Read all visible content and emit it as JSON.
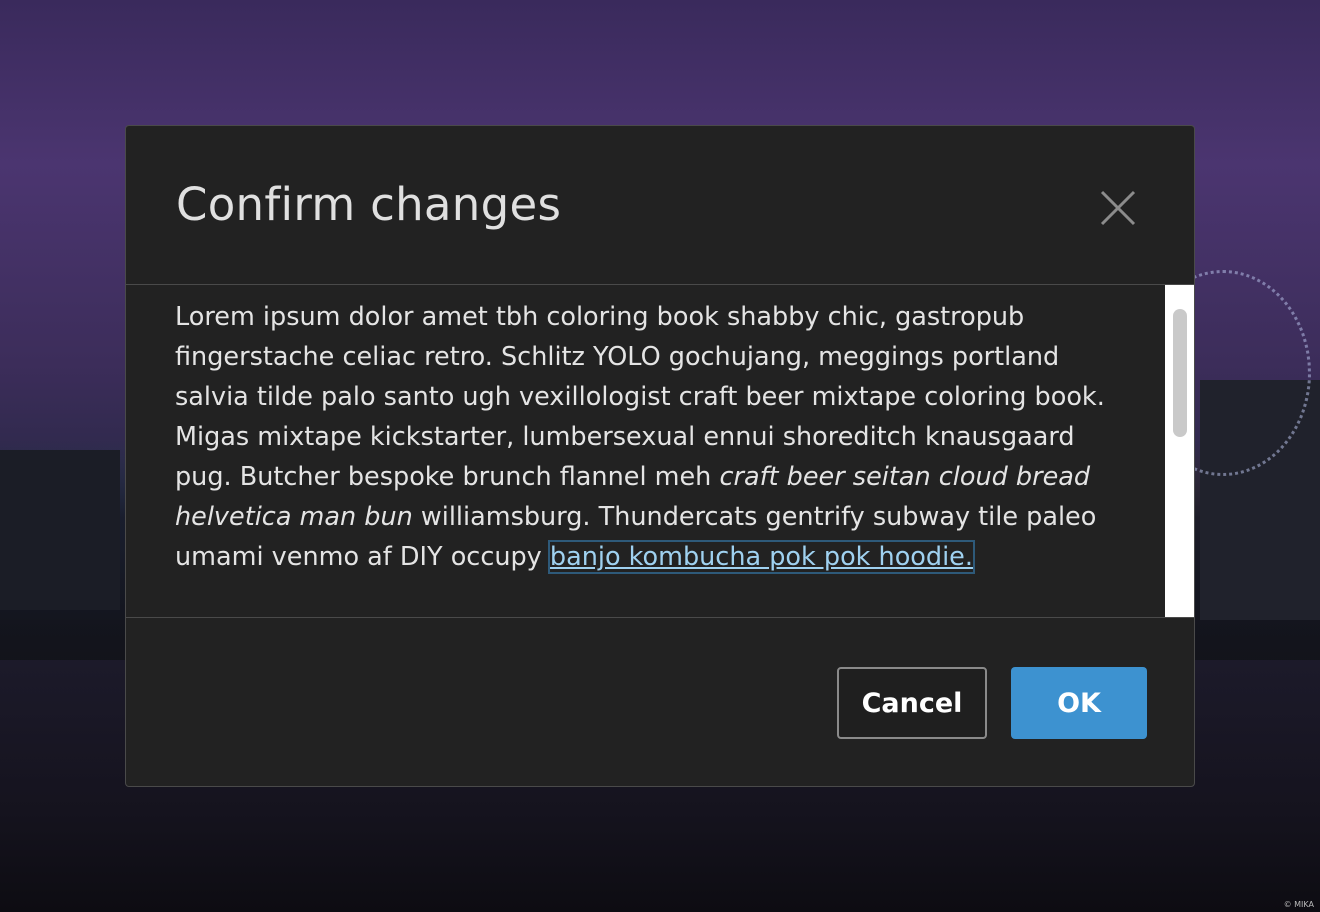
{
  "dialog": {
    "title": "Confirm changes",
    "close_icon": "close-icon",
    "body": {
      "text_1": "Lorem ipsum dolor amet tbh coloring book shabby chic, gastropub fingerstache celiac retro. Schlitz YOLO gochujang, meggings portland salvia tilde palo santo ugh vexillologist craft beer mixtape coloring book. Migas mixtape kickstarter, lumbersexual ennui shoreditch knausgaard pug. Butcher bespoke brunch flannel meh ",
      "italic": "craft beer seitan cloud bread helvetica man bun",
      "text_2": " williamsburg. Thundercats gentrify subway tile paleo umami venmo af DIY occupy ",
      "link": "banjo kombucha pok pok hoodie."
    },
    "cancel_label": "Cancel",
    "ok_label": "OK"
  },
  "background": {
    "credit": "© MIKA"
  },
  "colors": {
    "dialog_bg": "#222222",
    "primary": "#3d92d0",
    "link": "#9fd1f0",
    "border": "#4a4a4a"
  }
}
